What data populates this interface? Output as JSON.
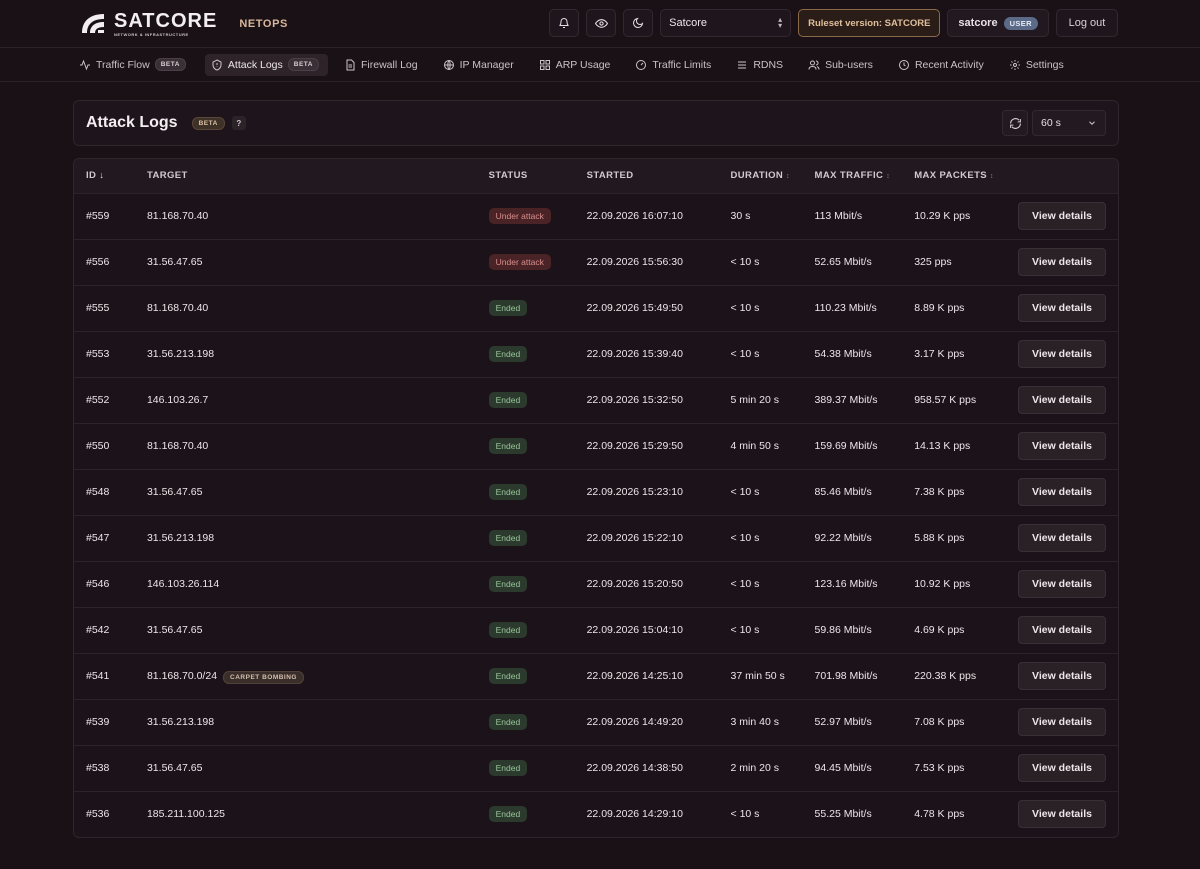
{
  "header": {
    "brand": "SATCORE",
    "brand_sub": "NETWORK & INFRASTRUCTURE",
    "section": "NETOPS",
    "org_select": "Satcore",
    "ruleset_label": "Ruleset version: SATCORE",
    "username": "satcore",
    "user_role": "USER",
    "logout_label": "Log out"
  },
  "nav": {
    "items": [
      {
        "label": "Traffic Flow",
        "icon": "activity-icon",
        "badge": "BETA"
      },
      {
        "label": "Attack Logs",
        "icon": "shield-icon",
        "badge": "BETA",
        "active": true
      },
      {
        "label": "Firewall Log",
        "icon": "document-icon"
      },
      {
        "label": "IP Manager",
        "icon": "globe-icon"
      },
      {
        "label": "ARP Usage",
        "icon": "grid-icon"
      },
      {
        "label": "Traffic Limits",
        "icon": "gauge-icon"
      },
      {
        "label": "RDNS",
        "icon": "list-icon"
      },
      {
        "label": "Sub-users",
        "icon": "users-icon"
      },
      {
        "label": "Recent Activity",
        "icon": "clock-icon"
      },
      {
        "label": "Settings",
        "icon": "gear-icon"
      }
    ]
  },
  "panel": {
    "title": "Attack Logs",
    "badge": "BETA",
    "help": "?",
    "interval": "60 s"
  },
  "table": {
    "columns": [
      "ID",
      "TARGET",
      "STATUS",
      "STARTED",
      "DURATION",
      "MAX TRAFFIC",
      "MAX PACKETS"
    ],
    "view_label": "View details",
    "rows": [
      {
        "id": "#559",
        "target": "81.168.70.40",
        "status": "Under attack",
        "started": "22.09.2026 16:07:10",
        "duration": "30 s",
        "traffic": "113 Mbit/s",
        "packets": "10.29 K pps"
      },
      {
        "id": "#556",
        "target": "31.56.47.65",
        "status": "Under attack",
        "started": "22.09.2026 15:56:30",
        "duration": "< 10 s",
        "traffic": "52.65 Mbit/s",
        "packets": "325 pps"
      },
      {
        "id": "#555",
        "target": "81.168.70.40",
        "status": "Ended",
        "started": "22.09.2026 15:49:50",
        "duration": "< 10 s",
        "traffic": "110.23 Mbit/s",
        "packets": "8.89 K pps"
      },
      {
        "id": "#553",
        "target": "31.56.213.198",
        "status": "Ended",
        "started": "22.09.2026 15:39:40",
        "duration": "< 10 s",
        "traffic": "54.38 Mbit/s",
        "packets": "3.17 K pps"
      },
      {
        "id": "#552",
        "target": "146.103.26.7",
        "status": "Ended",
        "started": "22.09.2026 15:32:50",
        "duration": "5 min 20 s",
        "traffic": "389.37 Mbit/s",
        "packets": "958.57 K pps"
      },
      {
        "id": "#550",
        "target": "81.168.70.40",
        "status": "Ended",
        "started": "22.09.2026 15:29:50",
        "duration": "4 min 50 s",
        "traffic": "159.69 Mbit/s",
        "packets": "14.13 K pps"
      },
      {
        "id": "#548",
        "target": "31.56.47.65",
        "status": "Ended",
        "started": "22.09.2026 15:23:10",
        "duration": "< 10 s",
        "traffic": "85.46 Mbit/s",
        "packets": "7.38 K pps"
      },
      {
        "id": "#547",
        "target": "31.56.213.198",
        "status": "Ended",
        "started": "22.09.2026 15:22:10",
        "duration": "< 10 s",
        "traffic": "92.22 Mbit/s",
        "packets": "5.88 K pps"
      },
      {
        "id": "#546",
        "target": "146.103.26.114",
        "status": "Ended",
        "started": "22.09.2026 15:20:50",
        "duration": "< 10 s",
        "traffic": "123.16 Mbit/s",
        "packets": "10.92 K pps"
      },
      {
        "id": "#542",
        "target": "31.56.47.65",
        "status": "Ended",
        "started": "22.09.2026 15:04:10",
        "duration": "< 10 s",
        "traffic": "59.86 Mbit/s",
        "packets": "4.69 K pps"
      },
      {
        "id": "#541",
        "target": "81.168.70.0/24",
        "tag": "CARPET BOMBING",
        "status": "Ended",
        "started": "22.09.2026 14:25:10",
        "duration": "37 min 50 s",
        "traffic": "701.98 Mbit/s",
        "packets": "220.38 K pps"
      },
      {
        "id": "#539",
        "target": "31.56.213.198",
        "status": "Ended",
        "started": "22.09.2026 14:49:20",
        "duration": "3 min 40 s",
        "traffic": "52.97 Mbit/s",
        "packets": "7.08 K pps"
      },
      {
        "id": "#538",
        "target": "31.56.47.65",
        "status": "Ended",
        "started": "22.09.2026 14:38:50",
        "duration": "2 min 20 s",
        "traffic": "94.45 Mbit/s",
        "packets": "7.53 K pps"
      },
      {
        "id": "#536",
        "target": "185.211.100.125",
        "status": "Ended",
        "started": "22.09.2026 14:29:10",
        "duration": "< 10 s",
        "traffic": "55.25 Mbit/s",
        "packets": "4.78 K pps"
      }
    ]
  },
  "colors": {
    "background": "#1a1117",
    "accent": "#d8b79a",
    "attack": "#d98f8f",
    "ended": "#98c49a"
  }
}
